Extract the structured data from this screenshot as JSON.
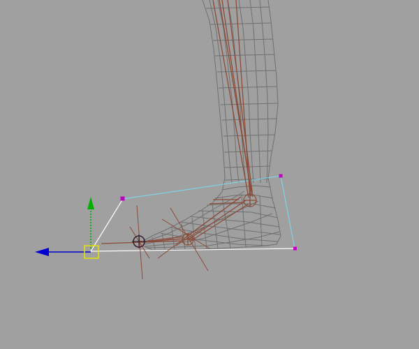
{
  "viewport": {
    "background_color": "#a0a0a0",
    "mesh_color": "#6f6f6f",
    "bone_color": "#8a4a36",
    "handle_color": "#c000c0",
    "bounds_cyan_color": "#7fd3e8",
    "bounds_white_color": "#ffffff",
    "axis_x_color": "#0000d0",
    "axis_y_color": "#00b000",
    "manipulator_color": "#e6e600",
    "icons": [
      "move-manipulator-icon",
      "pivot-target-icon"
    ]
  }
}
